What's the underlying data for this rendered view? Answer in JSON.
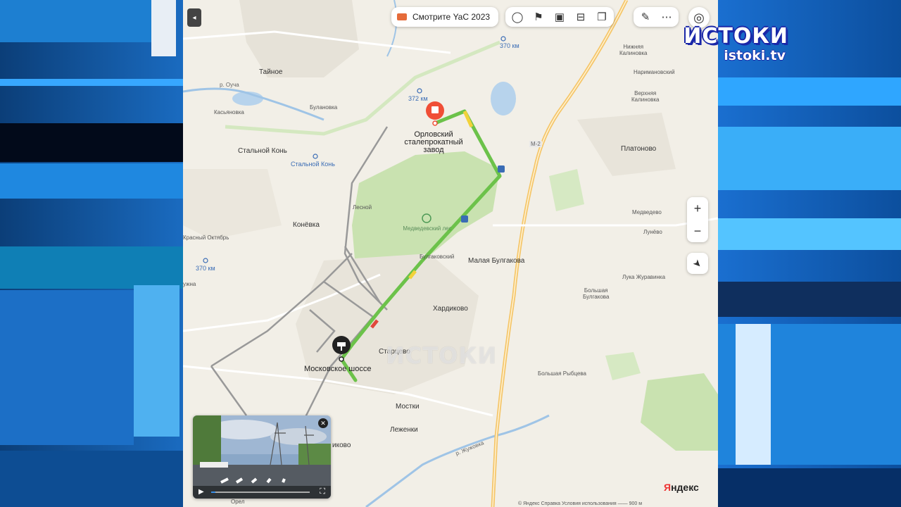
{
  "toolbar": {
    "collapse_icon": "chevron-left-icon",
    "promo_label": "Смотрите YaC 2023",
    "tools": [
      "layers-icon",
      "transit-icon",
      "camera-icon",
      "bus-icon",
      "panorama-icon",
      "ruler-icon",
      "more-icon",
      "profile-icon"
    ]
  },
  "controls": {
    "zoom_in": "+",
    "zoom_out": "−",
    "locate_icon": "navigation-arrow-icon"
  },
  "places": {
    "tainoe": "Тайное",
    "bulanovka": "Булановка",
    "kasyanovka": "Касьяновка",
    "stalnoy_kon": "Стальной Конь",
    "stalnoy_kon_station": "Стальной Конь",
    "konevka": "Конёвка",
    "lesnoy": "Лесной",
    "krasny_oktyabr": "Красный Октябрь",
    "uzhna": "ужна",
    "medvezhy_les": "Медведевский лес",
    "bulgakovsky": "Булгаковский",
    "malaya_bulgakova": "Малая Булгакова",
    "khardikovo": "Хардиково",
    "startsevo": "Старцево",
    "mostki": "Мостки",
    "lezhenki": "Леженки",
    "nikovo": "иково",
    "nizhnyaya_kalinovka": "Нижняя\nКалиновка",
    "narimanovsky": "Наримановский",
    "verkhnyaya_kalinovka": "Верхняя\nКалиновка",
    "platonovo": "Платоново",
    "medvedevo": "Медведево",
    "lunevo": "Лунёво",
    "luka_zhuravinka": "Лука Журавинка",
    "bolshaya_bulgakova": "Большая\nБулгакова",
    "bolshaya_rybtseva": "Большая Рыбцева",
    "orel": "Орел"
  },
  "km_markers": {
    "km370_top": "370 км",
    "km372": "372 км",
    "km370_left": "370 км"
  },
  "roads": {
    "m2": "М-2",
    "river": "р. Оуча",
    "zhuzhovka": "р. Жужовка"
  },
  "route": {
    "destination_label": "Орловский\nсталепрокатный\nзавод",
    "origin_label": "Московское шоссе"
  },
  "branding": {
    "logo_word": "ИСТОКИ",
    "logo_site": "istoki.tv",
    "watermark": "ИСТОКИ",
    "yandex_prefix": "Я",
    "yandex_rest": "ндекс",
    "copyright": "© Яндекс   Справка   Условия использования   ——  900 м"
  },
  "colors": {
    "route_green": "#6cc24a",
    "route_yellow": "#f2d23a",
    "route_red": "#e0483c",
    "highway": "#f5c66a",
    "forest": "#c9e2b0",
    "water": "#b7d3ec",
    "tv_blue": "#1d7fd1"
  }
}
